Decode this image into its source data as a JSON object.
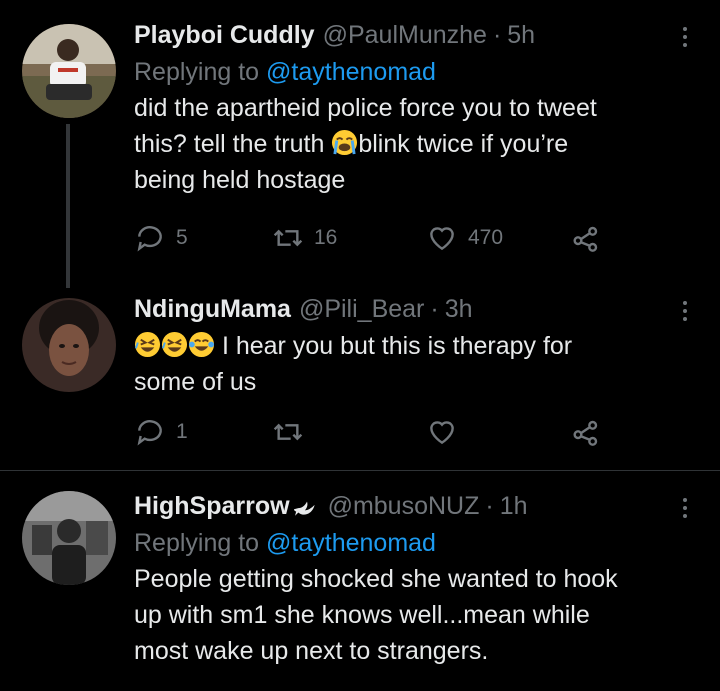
{
  "tweets": [
    {
      "name": "Playboi Cuddly",
      "handle": "@PaulMunzhe",
      "time": "5h",
      "reply_prefix": "Replying to",
      "reply_mention": "@taythenomad",
      "text_line1": "did the apartheid police force you to tweet",
      "text_line2a": "this? tell the truth ",
      "text_line2b": "blink twice if you’re",
      "text_line3": "being held hostage",
      "replies": "5",
      "retweets": "16",
      "likes": "470"
    },
    {
      "name": "NdinguMama",
      "handle": "@Pili_Bear",
      "time": "3h",
      "text_line1": " I hear you but this is therapy for",
      "text_line2": "some of us",
      "replies": "1",
      "retweets": "",
      "likes": ""
    },
    {
      "name": "HighSparrow",
      "handle": "@mbusoNUZ",
      "time": "1h",
      "reply_prefix": "Replying to",
      "reply_mention": "@taythenomad",
      "text_line1": "People getting shocked she wanted to hook",
      "text_line2": "up with sm1 she knows well...mean while",
      "text_line3": "most wake up next to strangers."
    }
  ],
  "icons": {
    "reply": "reply-icon",
    "retweet": "retweet-icon",
    "like": "heart-icon",
    "share": "share-icon",
    "more": "more-options-icon"
  },
  "colors": {
    "background": "#000000",
    "text": "#e7e9ea",
    "muted": "#71767b",
    "link": "#1d9bf0",
    "divider": "#2f3336"
  }
}
